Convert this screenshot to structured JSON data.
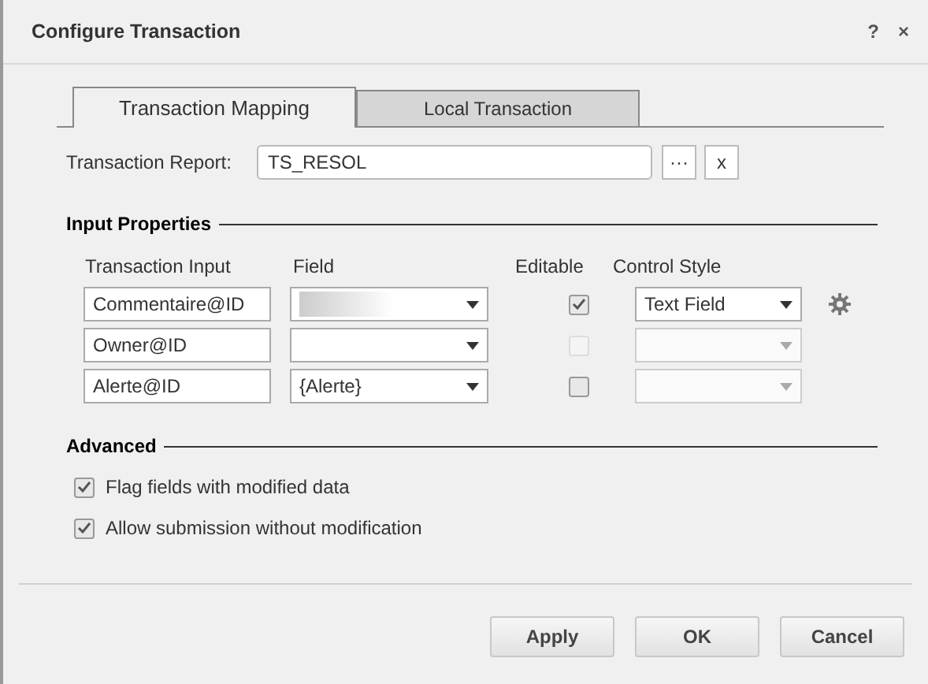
{
  "window": {
    "title": "Configure Transaction",
    "controls": [
      "?",
      "×"
    ]
  },
  "tabs": [
    {
      "label": "Transaction Mapping",
      "selected": true
    },
    {
      "label": "Local Transaction",
      "selected": false
    }
  ],
  "transaction_report": {
    "label": "Transaction Report:",
    "value": "TS_RESOL",
    "buttons": [
      "···",
      "x"
    ]
  },
  "input_properties": {
    "heading": "Input Properties",
    "columns": [
      "Transaction Input",
      "Field",
      "Editable",
      "Control Style"
    ],
    "rows": [
      {
        "input": "Commentaire@ID",
        "field_redacted": true,
        "editable": {
          "checked": true,
          "disabled": false
        },
        "control_style": {
          "value": "Text Field",
          "disabled": false
        },
        "has_settings": true
      },
      {
        "input": "Owner@ID",
        "field_redacted": false,
        "editable": {
          "checked": false,
          "disabled": true
        },
        "control_style": {
          "disabled": true
        },
        "has_settings": false
      },
      {
        "input": "Alerte@ID",
        "field": "{Alerte}",
        "field_redacted": false,
        "editable": {
          "checked": false,
          "disabled": false
        },
        "control_style": {
          "disabled": true
        },
        "has_settings": false
      }
    ]
  },
  "advanced": {
    "heading": "Advanced",
    "options": [
      {
        "label": "Flag fields with modified data",
        "checked": true
      },
      {
        "label": "Allow submission without modification",
        "checked": true
      }
    ]
  },
  "buttons": [
    "Apply",
    "OK",
    "Cancel"
  ]
}
